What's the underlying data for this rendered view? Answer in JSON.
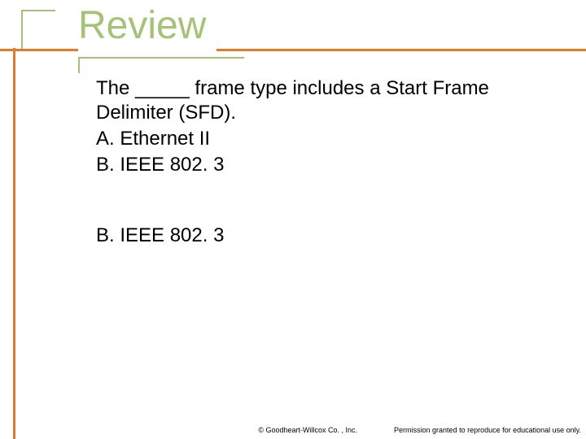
{
  "title": "Review",
  "question": "The _____ frame type includes a Start Frame Delimiter (SFD).",
  "options": [
    "A.  Ethernet II",
    "B.  IEEE 802. 3"
  ],
  "answer": "B.  IEEE 802. 3",
  "footer": {
    "copyright": "© Goodheart-Willcox Co. , Inc.",
    "permission": "Permission granted to reproduce for educational use only."
  },
  "colors": {
    "accent_green": "#a4c278",
    "accent_orange": "#e47a2c"
  }
}
